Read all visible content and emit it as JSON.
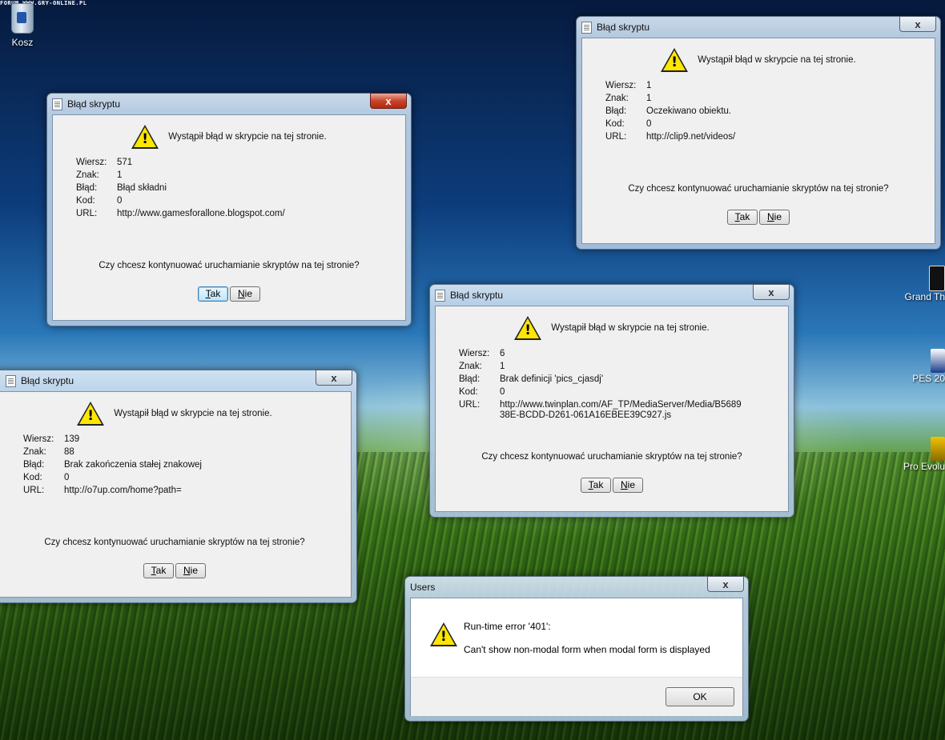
{
  "desktop": {
    "watermark": "FORUM WWW.GRY-ONLINE.PL",
    "recycle_bin": "Kosz",
    "right_icons": [
      "Grand Th",
      "PES 20",
      "Pro Evolu"
    ]
  },
  "dialog_common": {
    "title": "Błąd skryptu",
    "message": "Wystąpił błąd w skrypcie na tej stronie.",
    "label_line": "Wiersz:",
    "label_char": "Znak:",
    "label_error": "Błąd:",
    "label_code": "Kod:",
    "label_url": "URL:",
    "question": "Czy chcesz kontynuować uruchamianie skryptów na tej stronie?",
    "yes_u": "T",
    "yes_rest": "ak",
    "no_u": "N",
    "no_rest": "ie",
    "close": "x"
  },
  "dialogs": [
    {
      "line": "571",
      "char": "1",
      "error": "Błąd składni",
      "code": "0",
      "url": "http://www.gamesforallone.blogspot.com/"
    },
    {
      "line": "1",
      "char": "1",
      "error": "Oczekiwano obiektu.",
      "code": "0",
      "url": "http://clip9.net/videos/"
    },
    {
      "line": "6",
      "char": "1",
      "error": "Brak definicji 'pics_cjasdj'",
      "code": "0",
      "url": "http://www.twinplan.com/AF_TP/MediaServer/Media/B5689\n38E-BCDD-D261-061A16EBEE39C927.js"
    },
    {
      "line": "139",
      "char": "88",
      "error": "Brak zakończenia stałej znakowej",
      "code": "0",
      "url": "http://o7up.com/home?path="
    }
  ],
  "users_dialog": {
    "title": "Users",
    "error_title": "Run-time error '401':",
    "error_message": "Can't show non-modal form when modal form is displayed",
    "ok": "OK",
    "close": "x"
  },
  "colors": {
    "warning": "#ffe600",
    "close_active": "#c8452c"
  }
}
